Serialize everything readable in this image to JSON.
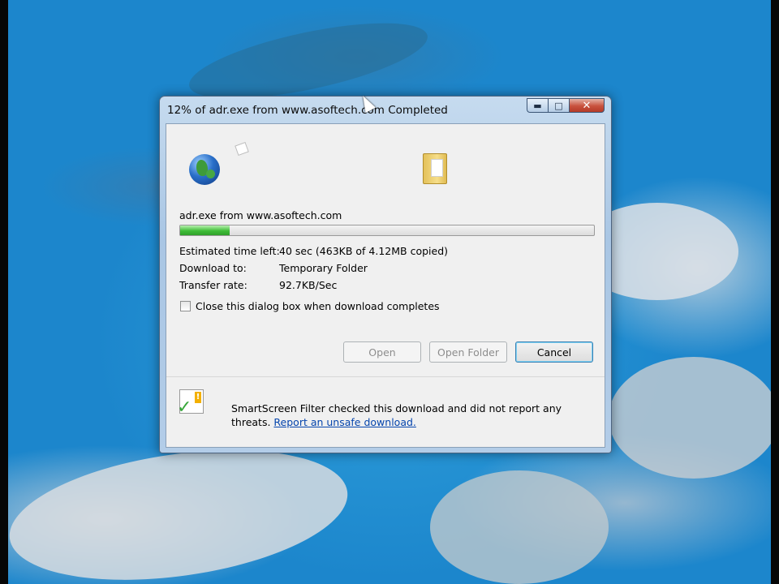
{
  "window": {
    "title": "12% of adr.exe from www.asoftech.com Completed",
    "controls": {
      "minimize": "▬",
      "maximize": "□",
      "close": "✕"
    }
  },
  "download": {
    "file_label": "adr.exe from www.asoftech.com",
    "progress_percent": 12,
    "rows": [
      {
        "label": "Estimated time left:",
        "value": "40 sec (463KB of 4.12MB copied)"
      },
      {
        "label": "Download to:",
        "value": "Temporary Folder"
      },
      {
        "label": "Transfer rate:",
        "value": "92.7KB/Sec"
      }
    ],
    "close_checkbox_label": "Close this dialog box when download completes",
    "close_checkbox_checked": false
  },
  "buttons": {
    "open": "Open",
    "open_folder": "Open Folder",
    "cancel": "Cancel"
  },
  "smartscreen": {
    "text": "SmartScreen Filter checked this download and did not report any threats.",
    "link": "Report an unsafe download."
  },
  "icons": {
    "globe": "globe-icon",
    "folder": "folder-icon",
    "shield": "smartscreen-shield-icon"
  },
  "colors": {
    "progress_fill": "#3fbd37",
    "desktop": "#1c86cc",
    "link": "#0645ad"
  }
}
